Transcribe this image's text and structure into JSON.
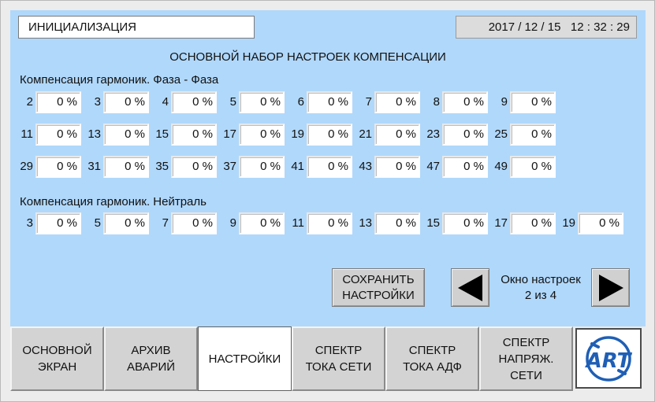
{
  "header": {
    "status": "ИНИЦИАЛИЗАЦИЯ",
    "datetime": "2017 / 12 / 15   12 : 32 : 29"
  },
  "main": {
    "title": "ОСНОВНОЙ НАБОР НАСТРОЕК КОМПЕНСАЦИИ",
    "phase_section": {
      "label": "Компенсация гармоник. Фаза - Фаза",
      "rows": [
        [
          {
            "harmonic": "2",
            "value": "0 %"
          },
          {
            "harmonic": "3",
            "value": "0 %"
          },
          {
            "harmonic": "4",
            "value": "0 %"
          },
          {
            "harmonic": "5",
            "value": "0 %"
          },
          {
            "harmonic": "6",
            "value": "0 %"
          },
          {
            "harmonic": "7",
            "value": "0 %"
          },
          {
            "harmonic": "8",
            "value": "0 %"
          },
          {
            "harmonic": "9",
            "value": "0 %"
          }
        ],
        [
          {
            "harmonic": "11",
            "value": "0 %"
          },
          {
            "harmonic": "13",
            "value": "0 %"
          },
          {
            "harmonic": "15",
            "value": "0 %"
          },
          {
            "harmonic": "17",
            "value": "0 %"
          },
          {
            "harmonic": "19",
            "value": "0 %"
          },
          {
            "harmonic": "21",
            "value": "0 %"
          },
          {
            "harmonic": "23",
            "value": "0 %"
          },
          {
            "harmonic": "25",
            "value": "0 %"
          }
        ],
        [
          {
            "harmonic": "29",
            "value": "0 %"
          },
          {
            "harmonic": "31",
            "value": "0 %"
          },
          {
            "harmonic": "35",
            "value": "0 %"
          },
          {
            "harmonic": "37",
            "value": "0 %"
          },
          {
            "harmonic": "41",
            "value": "0 %"
          },
          {
            "harmonic": "43",
            "value": "0 %"
          },
          {
            "harmonic": "47",
            "value": "0 %"
          },
          {
            "harmonic": "49",
            "value": "0 %"
          }
        ]
      ]
    },
    "neutral_section": {
      "label": "Компенсация гармоник. Нейтраль",
      "rows": [
        [
          {
            "harmonic": "3",
            "value": "0 %"
          },
          {
            "harmonic": "5",
            "value": "0 %"
          },
          {
            "harmonic": "7",
            "value": "0 %"
          },
          {
            "harmonic": "9",
            "value": "0 %"
          },
          {
            "harmonic": "11",
            "value": "0 %"
          },
          {
            "harmonic": "13",
            "value": "0 %"
          },
          {
            "harmonic": "15",
            "value": "0 %"
          },
          {
            "harmonic": "17",
            "value": "0 %"
          },
          {
            "harmonic": "19",
            "value": "0 %"
          }
        ]
      ]
    },
    "save_button": {
      "line1": "СОХРАНИТЬ",
      "line2": "НАСТРОЙКИ"
    },
    "pager": {
      "line1": "Окно настроек",
      "line2": "2 из 4",
      "prev_icon": "triangle-left-icon",
      "next_icon": "triangle-right-icon"
    }
  },
  "tabs": [
    {
      "line1": "ОСНОВНОЙ",
      "line2": "ЭКРАН",
      "line3": "",
      "active": false
    },
    {
      "line1": "АРХИВ",
      "line2": "АВАРИЙ",
      "line3": "",
      "active": false
    },
    {
      "line1": "НАСТРОЙКИ",
      "line2": "",
      "line3": "",
      "active": true
    },
    {
      "line1": "СПЕКТР",
      "line2": "ТОКА СЕТИ",
      "line3": "",
      "active": false
    },
    {
      "line1": "СПЕКТР",
      "line2": "ТОКА АДФ",
      "line3": "",
      "active": false
    },
    {
      "line1": "СПЕКТР",
      "line2": "НАПРЯЖ.",
      "line3": "СЕТИ",
      "active": false
    }
  ],
  "logo": {
    "text": "ART",
    "icon": "art-logo-icon"
  },
  "colors": {
    "panel": "#b0d8fb",
    "logo_blue": "#1f5fb5"
  }
}
